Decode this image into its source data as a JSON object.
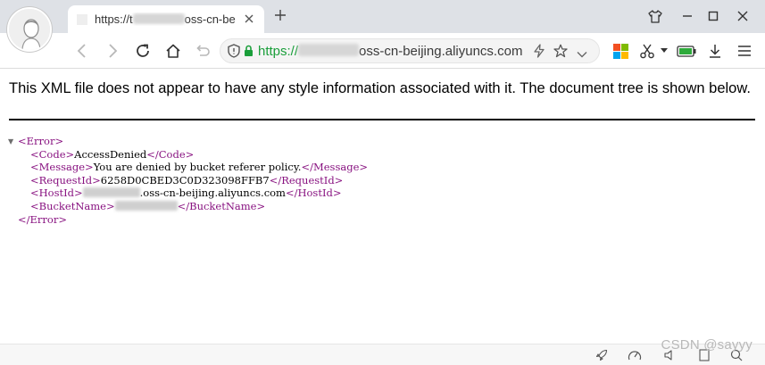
{
  "browser": {
    "tab": {
      "title_prefix": "https://t",
      "title_suffix": "oss-cn-be"
    },
    "address": {
      "scheme": "https://",
      "host_suffix": "oss-cn-beijing.aliyuncs.com"
    },
    "icons": {
      "back": "back-arrow-icon",
      "forward": "forward-arrow-icon",
      "reload": "reload-icon",
      "home": "home-icon",
      "undo": "undo-icon",
      "security": "shield-icon",
      "lock": "lock-icon",
      "boost": "lightning-icon",
      "bookmark": "star-icon",
      "dropdown": "chevron-down-icon",
      "apps": "windows-grid-icon",
      "cut": "scissors-icon",
      "battery": "battery-icon",
      "download": "download-icon",
      "menu": "hamburger-menu-icon",
      "shirt": "skin-shirt-icon",
      "minimize": "minimize-icon",
      "maximize": "maximize-icon",
      "close": "close-icon"
    },
    "colors": {
      "secure_green": "#1a9e3a",
      "tag_purple": "#881280",
      "battery_green": "#2eaa3b"
    }
  },
  "page": {
    "notice": "This XML file does not appear to have any style information associated with it. The document tree is shown below.",
    "xml": {
      "root_open": "<Error>",
      "root_close": "</Error>",
      "elements": [
        {
          "open": "<Code>",
          "value": "AccessDenied",
          "close": "</Code>"
        },
        {
          "open": "<Message>",
          "value": "You are denied by bucket referer policy.",
          "close": "</Message>"
        },
        {
          "open": "<RequestId>",
          "value": "6258D0CBED3C0D323098FFB7",
          "close": "</RequestId>"
        },
        {
          "open": "<HostId>",
          "value": ".oss-cn-beijing.aliyuncs.com",
          "close": "</HostId>"
        },
        {
          "open": "<BucketName>",
          "value": "",
          "close": "</BucketName>"
        }
      ]
    }
  },
  "watermark": "CSDN @sayyy"
}
